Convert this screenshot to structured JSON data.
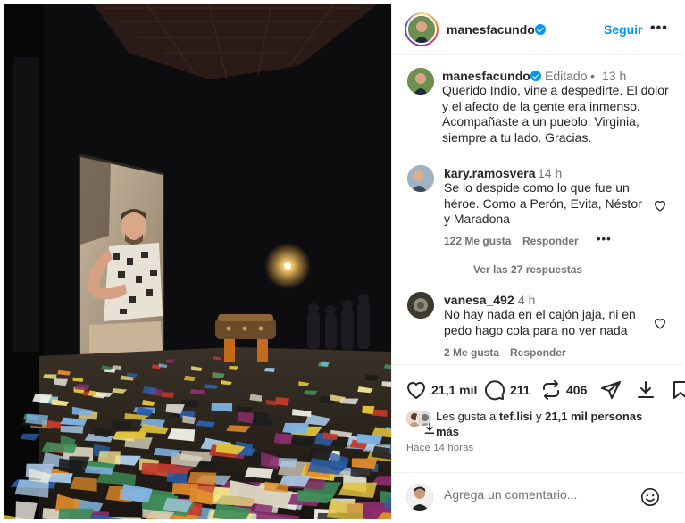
{
  "post": {
    "username": "manesfacundo",
    "follow_label": "Seguir",
    "more_label": "•••",
    "caption": {
      "username": "manesfacundo",
      "edited_label": "Editado",
      "separator": "•",
      "time": "13 h",
      "text": "Querido Indio, vine a despedirte. El dolor y el afecto de la gente era inmenso. Acompañaste a un pueblo. Virginia, siempre a tu lado. Gracias."
    },
    "comments": [
      {
        "username": "kary.ramosvera",
        "time": "14 h",
        "text": "Se lo despide como lo que fue un héroe. Como a Perón, Evita, Néstor y Maradona",
        "likes": "122 Me gusta",
        "reply_label": "Responder",
        "more_label": "•••",
        "view_replies": "Ver las 27 respuestas"
      },
      {
        "username": "vanesa_492",
        "time": "4 h",
        "text": "No hay nada en el cajón jaja, ni en pedo hago cola para no ver nada",
        "likes": "2 Me gusta",
        "reply_label": "Responder"
      }
    ],
    "actions": {
      "likes_count": "21,1 mil",
      "comments_count": "211",
      "reposts_count": "406"
    },
    "liked_by": {
      "prefix": "Les gusta a ",
      "user": "tef.lisi",
      "middle": " y ",
      "others": "21,1 mil personas",
      "suffix_line2": "más"
    },
    "timestamp": "Hace 14 horas",
    "comment_input": {
      "placeholder": "Agrega un comentario..."
    }
  },
  "colors": {
    "accent": "#0095f6",
    "text": "#262626",
    "muted": "#737373",
    "border": "#efefef"
  },
  "icons": [
    "verified-badge-icon",
    "heart-icon",
    "comment-icon",
    "repost-icon",
    "share-icon",
    "download-icon",
    "save-icon",
    "emoji-icon",
    "more-icon"
  ]
}
